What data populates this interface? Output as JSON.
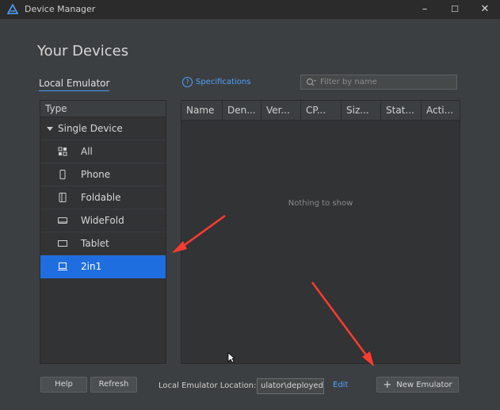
{
  "window": {
    "title": "Device Manager",
    "controls": {
      "minimize": "–",
      "maximize": "☐",
      "close": "✕"
    }
  },
  "heading": "Your Devices",
  "tabs": {
    "local_emulator": "Local Emulator"
  },
  "specifications_link": "Specifications",
  "filter": {
    "placeholder": "Filter by name",
    "value": ""
  },
  "left_panel": {
    "header": "Type",
    "group": "Single Device",
    "items": [
      {
        "label": "All",
        "icon": "grid-icon",
        "selected": false
      },
      {
        "label": "Phone",
        "icon": "phone-icon",
        "selected": false
      },
      {
        "label": "Foldable",
        "icon": "foldable-icon",
        "selected": false
      },
      {
        "label": "WideFold",
        "icon": "widefold-icon",
        "selected": false
      },
      {
        "label": "Tablet",
        "icon": "tablet-icon",
        "selected": false
      },
      {
        "label": "2in1",
        "icon": "laptop-icon",
        "selected": true
      }
    ]
  },
  "table": {
    "columns": [
      "Name",
      "Den...",
      "Ver...",
      "CP...",
      "Siz...",
      "Stat...",
      "Acti..."
    ],
    "empty_text": "Nothing to show"
  },
  "footer": {
    "help_label": "Help",
    "refresh_label": "Refresh",
    "location_label": "Local Emulator Location:",
    "location_value": "ulator\\deployed",
    "edit_label": "Edit",
    "new_emulator_label": "New Emulator",
    "new_emulator_icon": "+"
  },
  "colors": {
    "accent": "#1f6ee0",
    "link": "#4ea1ff",
    "annotation_arrow": "#ff3b30"
  }
}
